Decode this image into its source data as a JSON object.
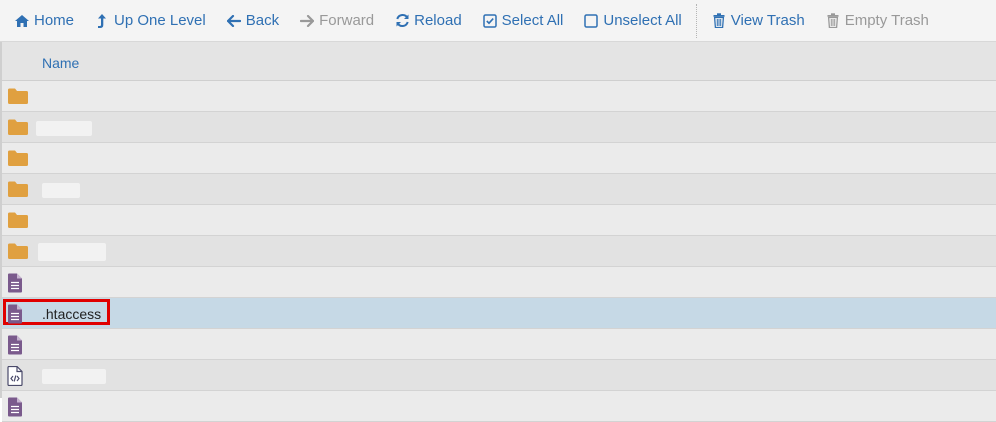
{
  "toolbar": {
    "home": "Home",
    "up": "Up One Level",
    "back": "Back",
    "forward": "Forward",
    "reload": "Reload",
    "select_all": "Select All",
    "unselect_all": "Unselect All",
    "view_trash": "View Trash",
    "empty_trash": "Empty Trash"
  },
  "grid": {
    "header_name": "Name",
    "rows": [
      {
        "type": "folder",
        "name": ""
      },
      {
        "type": "folder",
        "name": ""
      },
      {
        "type": "folder",
        "name": ""
      },
      {
        "type": "folder",
        "name": ""
      },
      {
        "type": "folder",
        "name": ""
      },
      {
        "type": "folder",
        "name": ""
      },
      {
        "type": "file",
        "name": ""
      },
      {
        "type": "file",
        "name": ".htaccess",
        "selected": true
      },
      {
        "type": "file",
        "name": ""
      },
      {
        "type": "code-file",
        "name": ""
      },
      {
        "type": "file",
        "name": ""
      }
    ]
  },
  "colors": {
    "accent": "#2f70b3",
    "folder": "#e0a040",
    "file": "#7a5a8c",
    "selected_row": "#c6d9e6",
    "highlight": "#e00000"
  }
}
